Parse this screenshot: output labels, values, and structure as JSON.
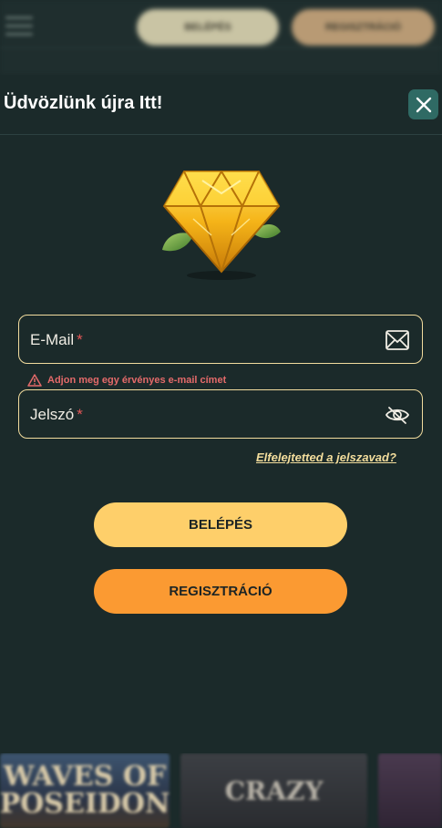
{
  "topbar": {
    "login_label": "BELÉPÉS",
    "register_label": "REGISZTRÁCIÓ"
  },
  "modal": {
    "title": "Üdvözlünk újra Itt!",
    "email": {
      "label": "E-Mail",
      "required_mark": "*",
      "icon": "envelope-icon"
    },
    "email_error": "Adjon meg egy érvényes e-mail címet",
    "password": {
      "label": "Jelszó",
      "required_mark": "*",
      "icon": "eye-slash-icon"
    },
    "forgot_password": "Elfelejtetted a jelszavad?",
    "login_button": "BELÉPÉS",
    "register_button": "REGISZTRÁCIÓ"
  },
  "games": {
    "tile1_title": "WAVES OF POSEIDON",
    "tile2_title": "CRAZY"
  },
  "colors": {
    "background": "#1b2a2a",
    "accent_yellow": "#fecf6a",
    "accent_orange": "#fb9a32",
    "close_button": "#2f6a64",
    "error": "#e46a6a",
    "field_border": "#f2dc9e"
  }
}
